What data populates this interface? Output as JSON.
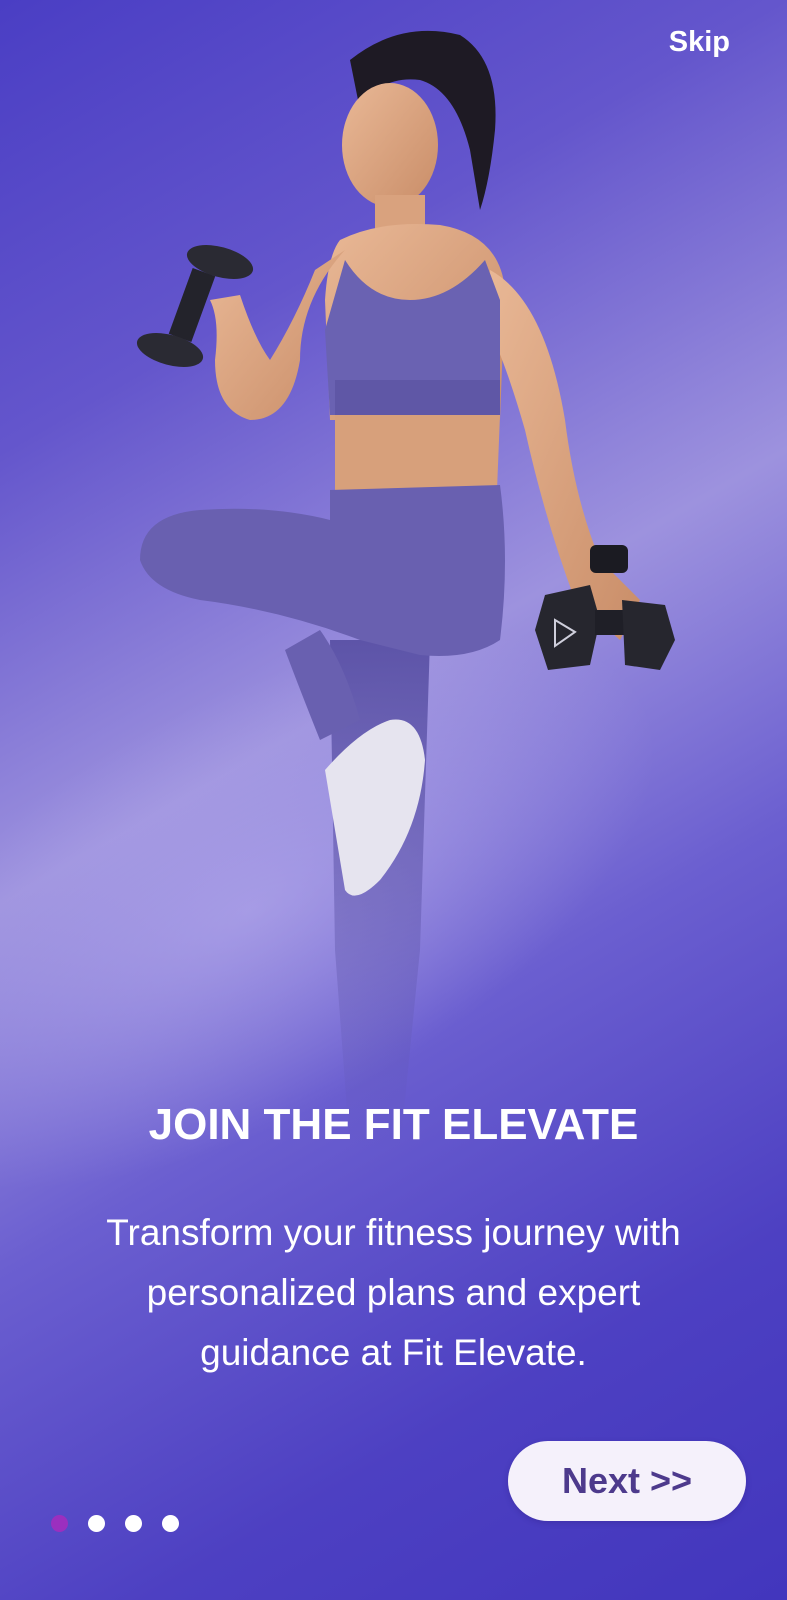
{
  "header": {
    "skip_label": "Skip"
  },
  "hero": {
    "image": "woman-with-dumbbells"
  },
  "content": {
    "title": "JOIN THE FIT ELEVATE",
    "description_lines": [
      "Transform your fitness journey with",
      "personalized plans and expert",
      "guidance at Fit Elevate."
    ]
  },
  "pagination": {
    "total": 4,
    "active_index": 0,
    "active_color": "#9b2fbf",
    "inactive_color": "#ffffff"
  },
  "footer": {
    "next_label": "Next >>"
  },
  "colors": {
    "background_primary": "#4a3ec4",
    "button_bg": "#f5f1fb",
    "button_text": "#4d3a8c"
  }
}
